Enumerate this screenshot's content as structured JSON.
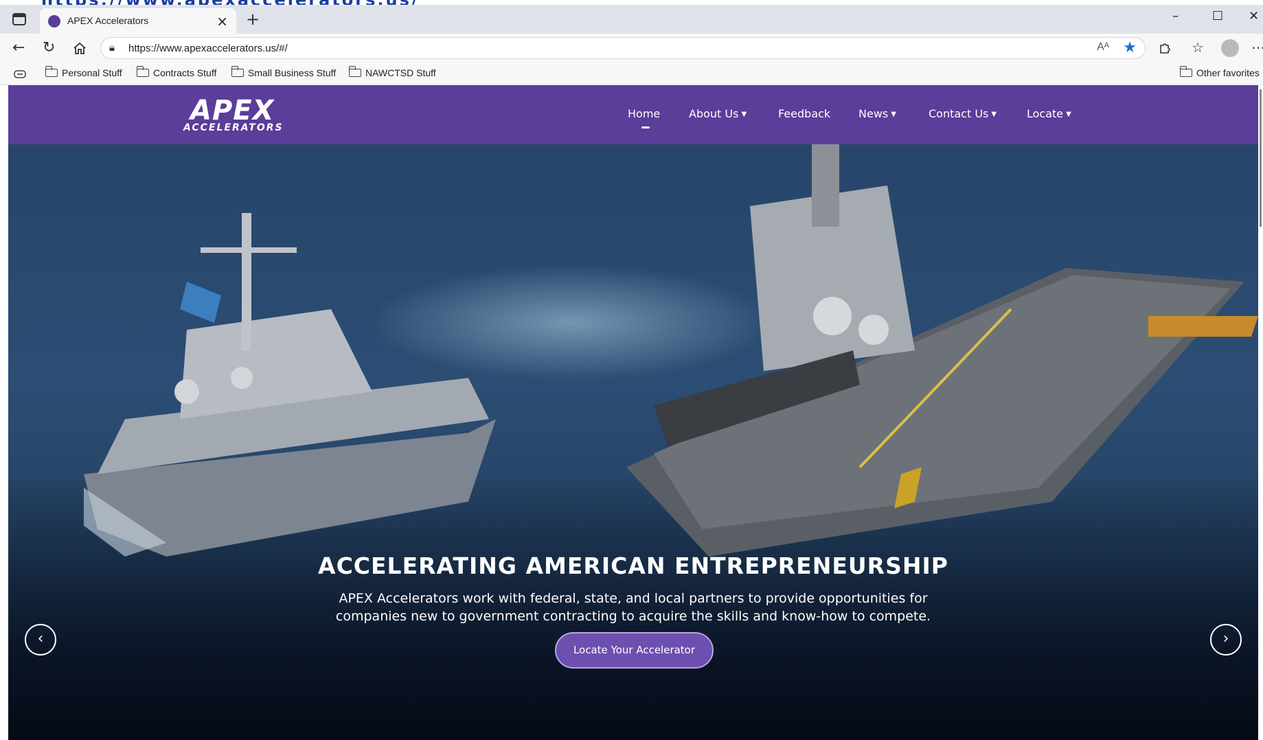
{
  "browser": {
    "tab": {
      "title": "APEX Accelerators",
      "close": "×"
    },
    "new_tab": "+",
    "window_controls": {
      "minimize": "–",
      "maximize": "☐",
      "close": "✕"
    },
    "address": {
      "url": "https://www.apexaccelerators.us/#/",
      "read_aloud": "Aᴬ"
    },
    "favorites": [
      {
        "label": "Personal Stuff"
      },
      {
        "label": "Contracts Stuff"
      },
      {
        "label": "Small Business Stuff"
      },
      {
        "label": "NAWCTSD Stuff"
      }
    ],
    "other_favorites": "Other favorites",
    "icons": {
      "back": "back-arrow-icon",
      "refresh": "refresh-icon",
      "home": "home-icon",
      "favorite": "star-icon",
      "extensions": "extensions-icon",
      "collections": "favorites-list-icon",
      "profile": "profile-icon",
      "more": "more-icon"
    }
  },
  "site": {
    "logo": {
      "line1": "APEX",
      "line2": "ACCELERATORS"
    },
    "nav": [
      {
        "label": "Home",
        "has_dropdown": false,
        "active": true
      },
      {
        "label": "About Us",
        "has_dropdown": true
      },
      {
        "label": "Feedback",
        "has_dropdown": false
      },
      {
        "label": "News",
        "has_dropdown": true
      },
      {
        "label": "Contact Us",
        "has_dropdown": true
      },
      {
        "label": "Locate",
        "has_dropdown": true
      }
    ],
    "hero": {
      "title": "ACCELERATING AMERICAN ENTREPRENEURSHIP",
      "description": "APEX Accelerators work with federal, state, and local partners to provide opportunities for companies new to government contracting to acquire the skills and know-how to compete.",
      "button": "Locate Your Accelerator",
      "prev": "‹",
      "next": "›"
    },
    "colors": {
      "brand_purple": "#5b3d9a",
      "button_purple": "#6d4fb0"
    }
  }
}
